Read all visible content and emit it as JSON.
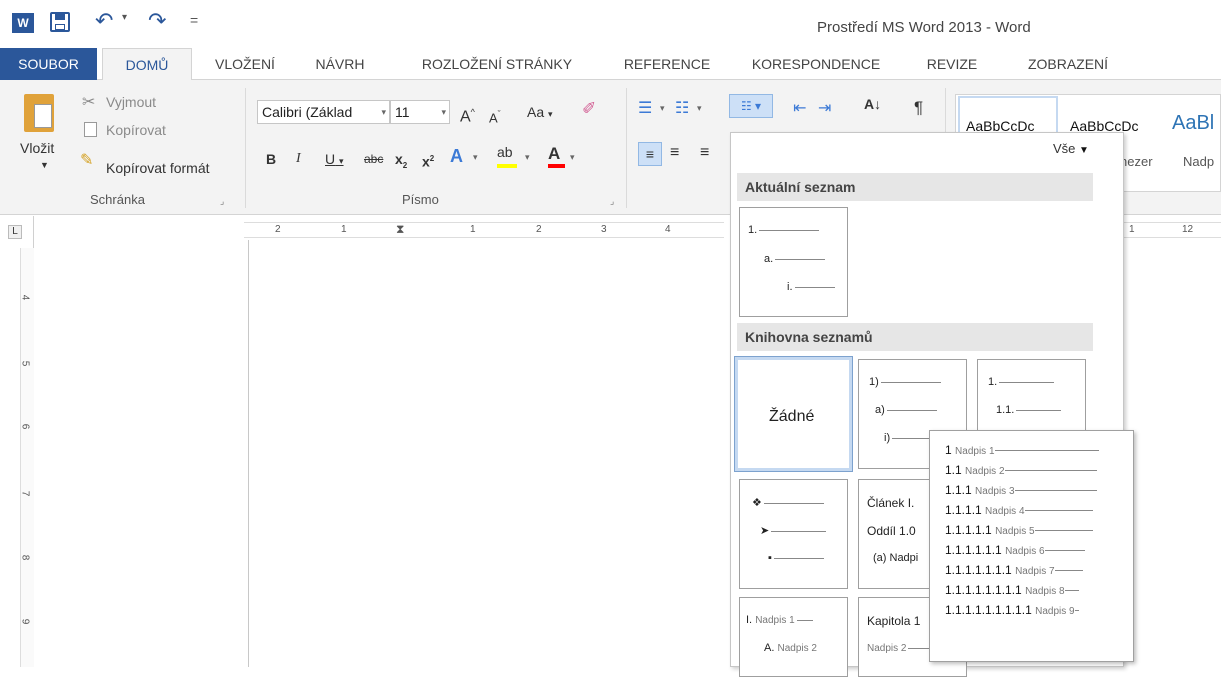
{
  "window": {
    "title": "Prostředí MS Word 2013 - Word"
  },
  "quick_access": {
    "word_icon": "W",
    "save": "save-icon",
    "undo": "undo-icon",
    "redo": "redo-icon",
    "customize": "="
  },
  "tabs": [
    "SOUBOR",
    "DOMŮ",
    "VLOŽENÍ",
    "NÁVRH",
    "ROZLOŽENÍ STRÁNKY",
    "REFERENCE",
    "KORESPONDENCE",
    "REVIZE",
    "ZOBRAZENÍ"
  ],
  "clipboard": {
    "paste": "Vložit",
    "cut": "Vyjmout",
    "copy": "Kopírovat",
    "format_painter": "Kopírovat formát",
    "group": "Schránka"
  },
  "font": {
    "name": "Calibri (Základ",
    "size": "11",
    "grow": "A",
    "shrink": "A",
    "change_case": "Aa",
    "bold": "B",
    "italic": "I",
    "underline": "U",
    "strike": "abc",
    "subscript": "x",
    "superscript": "x",
    "group": "Písmo"
  },
  "paragraph": {
    "show_marks": "¶"
  },
  "styles": {
    "s1": "AaBbCcDc",
    "s2": "AaBbCcDc",
    "s3": "AaBl",
    "label2": "nezer",
    "label3": "Nadp"
  },
  "ruler": {
    "left_ticks": [
      "2",
      "1",
      "1",
      "2",
      "3",
      "4"
    ],
    "right_ticks": [
      "1",
      "12"
    ],
    "tab_selector": "L",
    "vertical_ticks": [
      "4",
      "5",
      "6",
      "7",
      "8",
      "9"
    ]
  },
  "dropdown": {
    "all_label": "Vše",
    "current_header": "Aktuální seznam",
    "library_header": "Knihovna seznamů",
    "current": [
      "1.",
      "a.",
      "i."
    ],
    "none_label": "Žádné",
    "thumb_paren": [
      "1)",
      "a)",
      "i)"
    ],
    "thumb_decimal": [
      "1.",
      "1.1."
    ],
    "bullets": [
      "❖",
      "➤",
      "▪"
    ],
    "article": [
      "Článek I.",
      "Oddíl 1.0",
      "(a) Nadpi"
    ],
    "roman": [
      "I.",
      "Nadpis 1",
      "A.",
      "Nadpis 2"
    ],
    "chapter": [
      "Kapitola 1",
      "Nadpis 2"
    ]
  },
  "tooltip": {
    "rows": [
      {
        "num": "1",
        "label": "Nadpis 1"
      },
      {
        "num": "1.1",
        "label": "Nadpis 2"
      },
      {
        "num": "1.1.1",
        "label": "Nadpis 3"
      },
      {
        "num": "1.1.1.1",
        "label": "Nadpis 4"
      },
      {
        "num": "1.1.1.1.1",
        "label": "Nadpis 5"
      },
      {
        "num": "1.1.1.1.1.1",
        "label": "Nadpis 6"
      },
      {
        "num": "1.1.1.1.1.1.1",
        "label": "Nadpis 7"
      },
      {
        "num": "1.1.1.1.1.1.1.1",
        "label": "Nadpis 8"
      },
      {
        "num": "1.1.1.1.1.1.1.1.1",
        "label": "Nadpis 9"
      }
    ]
  },
  "colors": {
    "accent": "#2b579a",
    "highlight": "#ffff00",
    "font_color": "#ff0000"
  }
}
